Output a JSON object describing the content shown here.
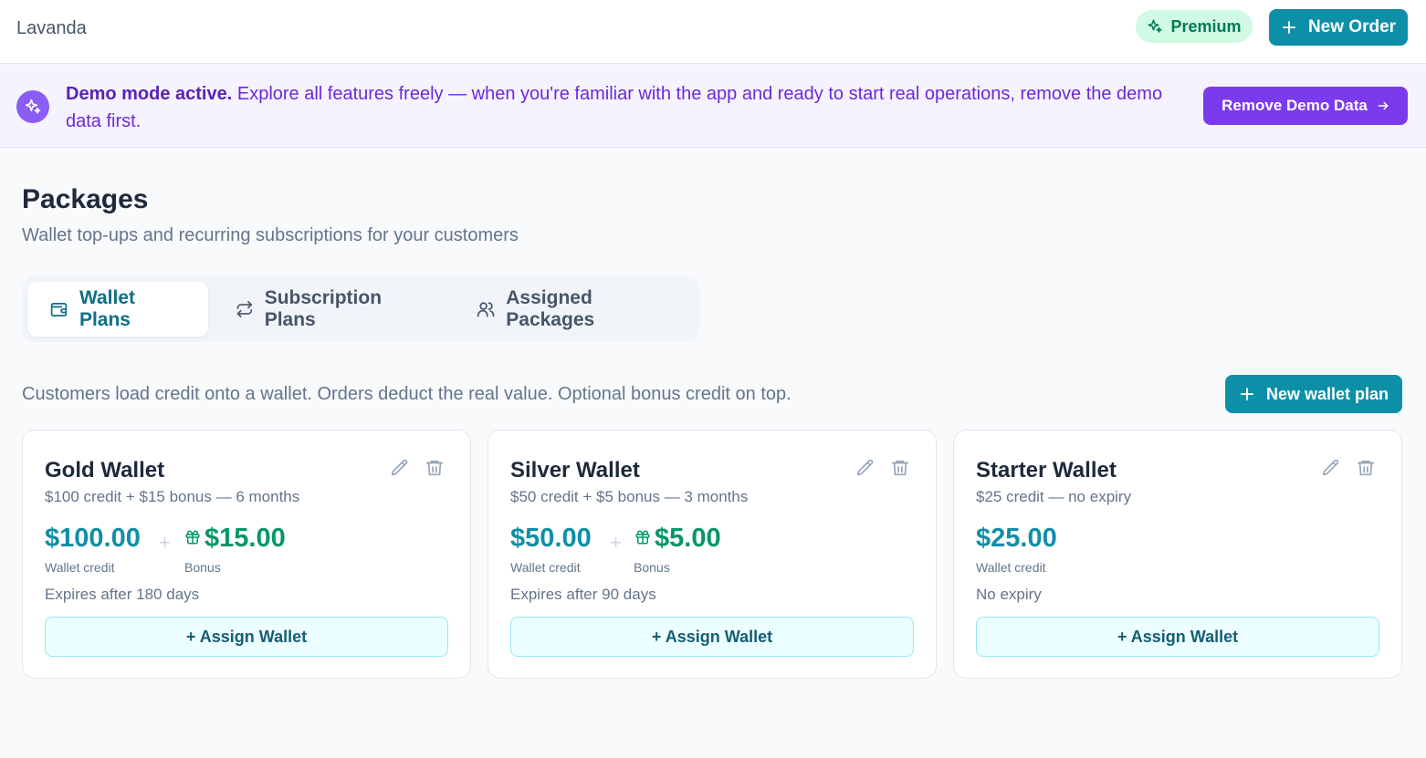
{
  "app": {
    "name": "Lavanda"
  },
  "header": {
    "premium_label": "Premium",
    "new_order_label": "New Order"
  },
  "banner": {
    "title": "Demo mode active.",
    "message": " Explore all features freely — when you're familiar with the app and ready to start real operations, remove the demo data first.",
    "button_label": "Remove Demo Data"
  },
  "page": {
    "title": "Packages",
    "subtitle": "Wallet top-ups and recurring subscriptions for your customers"
  },
  "tabs": [
    {
      "label": "Wallet Plans",
      "icon": "wallet-icon",
      "active": true
    },
    {
      "label": "Subscription Plans",
      "icon": "repeat-icon",
      "active": false
    },
    {
      "label": "Assigned Packages",
      "icon": "users-icon",
      "active": false
    }
  ],
  "section": {
    "description": "Customers load credit onto a wallet. Orders deduct the real value. Optional bonus credit on top.",
    "new_plan_label": "New wallet plan"
  },
  "plans": [
    {
      "name": "Gold Wallet",
      "summary": "$100 credit + $15 bonus — 6 months",
      "credit": "$100.00",
      "credit_label": "Wallet credit",
      "plus": "+",
      "bonus": "$15.00",
      "bonus_label": "Bonus",
      "expiry": "Expires after 180 days",
      "assign_label": "+ Assign Wallet"
    },
    {
      "name": "Silver Wallet",
      "summary": "$50 credit + $5 bonus — 3 months",
      "credit": "$50.00",
      "credit_label": "Wallet credit",
      "plus": "+",
      "bonus": "$5.00",
      "bonus_label": "Bonus",
      "expiry": "Expires after 90 days",
      "assign_label": "+ Assign Wallet"
    },
    {
      "name": "Starter Wallet",
      "summary": "$25 credit — no expiry",
      "credit": "$25.00",
      "credit_label": "Wallet credit",
      "expiry": "No expiry",
      "assign_label": "+ Assign Wallet"
    }
  ],
  "colors": {
    "primary": "#0e8fa8",
    "demo_accent": "#7c3aed",
    "bonus": "#059669",
    "premium_bg": "#d1fae5"
  }
}
